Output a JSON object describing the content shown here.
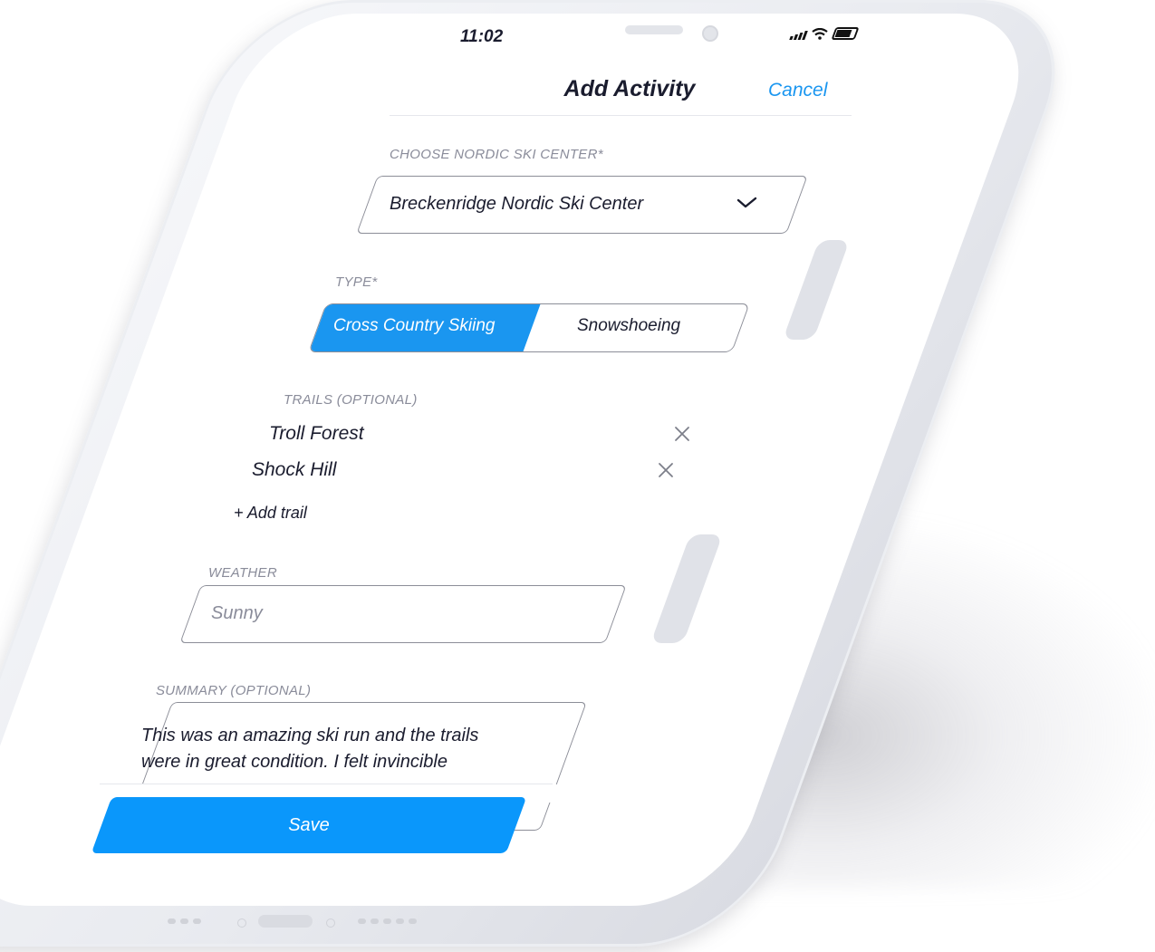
{
  "status": {
    "time": "11:02"
  },
  "header": {
    "title": "Add Activity",
    "cancel_label": "Cancel"
  },
  "form": {
    "center": {
      "label": "CHOOSE NORDIC SKI CENTER*",
      "value": "Breckenridge Nordic Ski Center"
    },
    "type": {
      "label": "TYPE*",
      "options": [
        "Cross Country Skiing",
        "Snowshoeing"
      ],
      "selected": "Cross Country Skiing"
    },
    "trails": {
      "label": "TRAILS (OPTIONAL)",
      "items": [
        "Troll Forest",
        "Shock Hill"
      ],
      "add_label": "+ Add trail"
    },
    "weather": {
      "label": "WEATHER",
      "placeholder": "Sunny"
    },
    "summary": {
      "label": "SUMMARY (OPTIONAL)",
      "value": "This was an amazing ski run and the trails were in great condition. I felt invincible"
    },
    "save_label": "Save"
  },
  "colors": {
    "accent": "#1a96f0",
    "save_button": "#0a97fb",
    "text_dark": "#1a1c2e",
    "label_gray": "#8a8c9a"
  },
  "icons": {
    "dropdown": "chevron-down-icon",
    "remove": "close-icon",
    "signal": "cellular-signal-icon",
    "wifi": "wifi-icon",
    "battery": "battery-icon"
  }
}
